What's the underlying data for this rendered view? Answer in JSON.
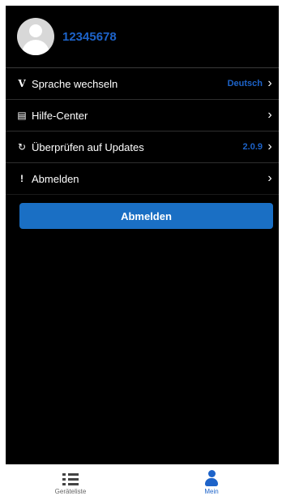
{
  "profile": {
    "username": "12345678"
  },
  "menu": [
    {
      "icon": "language-icon",
      "glyph": "V",
      "label": "Sprache wechseln",
      "value": "Deutsch"
    },
    {
      "icon": "help-document-icon",
      "glyph": "▤",
      "label": "Hilfe-Center",
      "value": ""
    },
    {
      "icon": "refresh-icon",
      "glyph": "↻",
      "label": "Überprüfen auf Updates",
      "value": "2.0.9"
    },
    {
      "icon": "exclamation-icon",
      "glyph": "!",
      "label": "Abmelden",
      "value": ""
    }
  ],
  "logout_button": {
    "label": "Abmelden"
  },
  "tabs": [
    {
      "icon": "list-icon",
      "label": "Geräteliste",
      "active": false
    },
    {
      "icon": "person-icon",
      "label": "Mein",
      "active": true
    }
  ],
  "colors": {
    "accent": "#1d63c9",
    "button": "#1a6fc4",
    "background": "#000000"
  }
}
